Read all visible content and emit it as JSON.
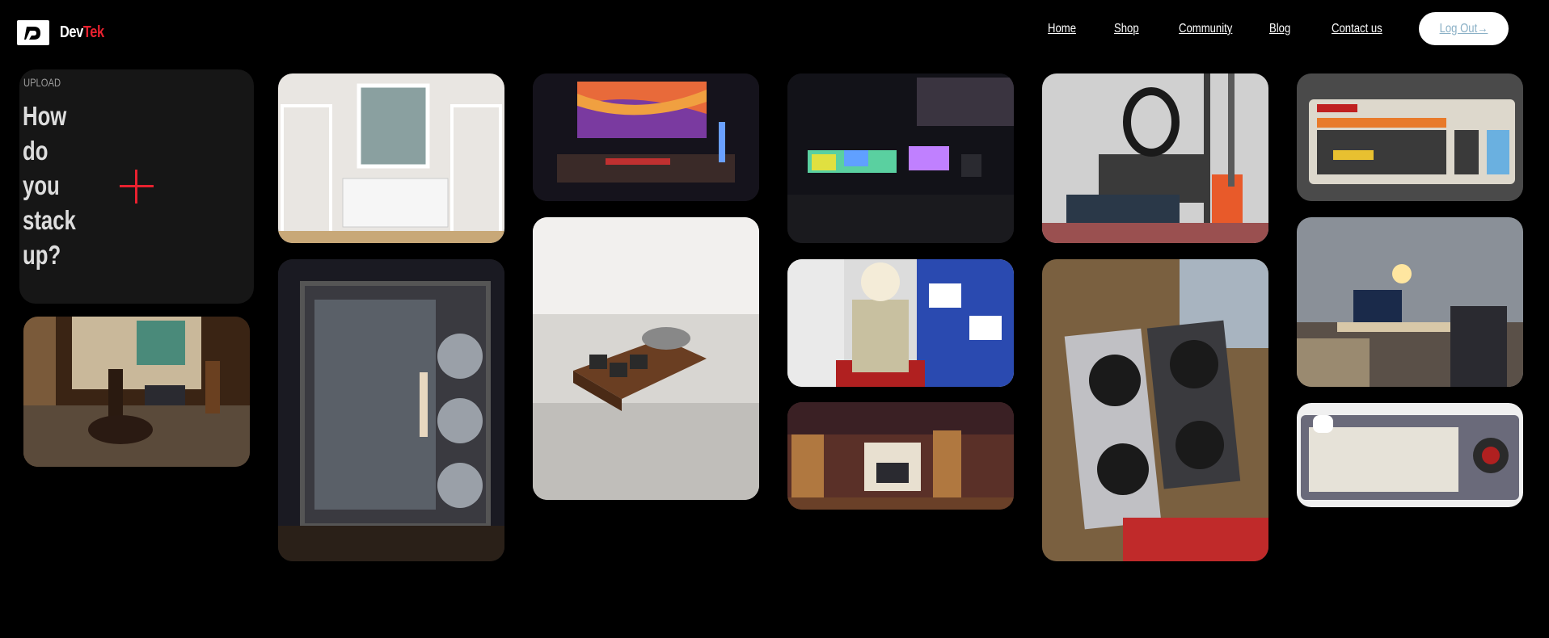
{
  "header": {
    "logo_icon": "logo-d-icon",
    "brand_part1": "Dev",
    "brand_part2": "Tek",
    "nav": {
      "home": "Home",
      "shop": "Shop",
      "community": "Community",
      "blog": "Blog",
      "contact": "Contact us"
    },
    "logout": "Log Out→"
  },
  "upload": {
    "label": "UPLOAD",
    "question": "How do you stack up?",
    "icon": "plus-icon"
  },
  "colors": {
    "accent": "#e8212f",
    "card_bg": "#161616",
    "page_bg": "#000000"
  }
}
